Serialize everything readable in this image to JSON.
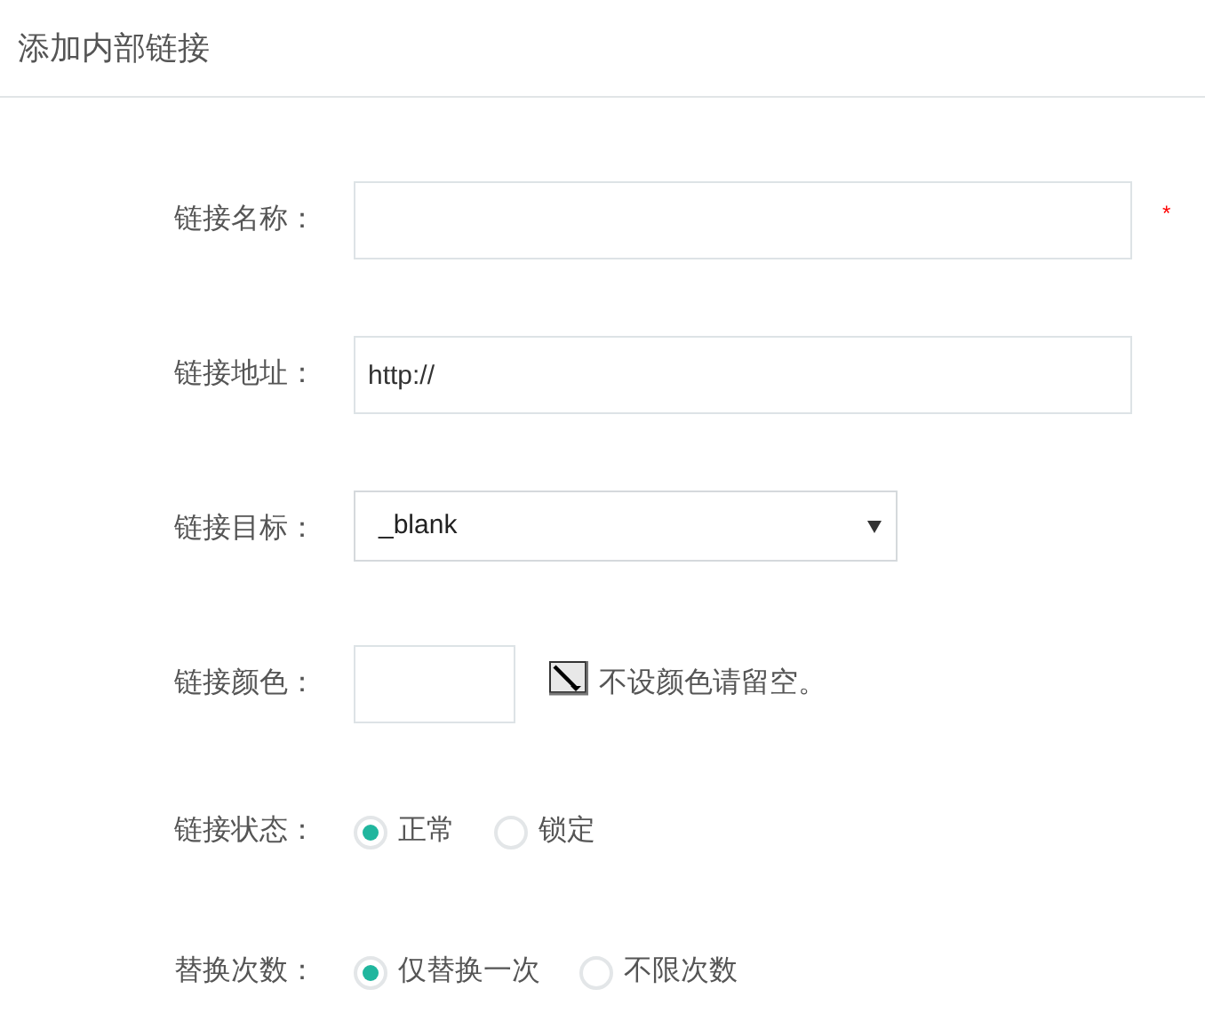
{
  "title": "添加内部链接",
  "fields": [
    {
      "kind": "text",
      "label": "链接名称：",
      "required_mark": "*"
    },
    {
      "kind": "text",
      "label": "链接地址：",
      "value": "http://"
    },
    {
      "kind": "select",
      "label": "链接目标：",
      "value": "_blank"
    },
    {
      "kind": "color",
      "label": "链接颜色：",
      "hint": "不设颜色请留空。"
    },
    {
      "kind": "radio",
      "label": "链接状态：",
      "options": [
        {
          "label": "正常",
          "selected": true
        },
        {
          "label": "锁定",
          "selected": false
        }
      ]
    },
    {
      "kind": "radio",
      "label": "替换次数：",
      "options": [
        {
          "label": "仅替换一次",
          "selected": true
        },
        {
          "label": "不限次数",
          "selected": false
        }
      ]
    }
  ]
}
